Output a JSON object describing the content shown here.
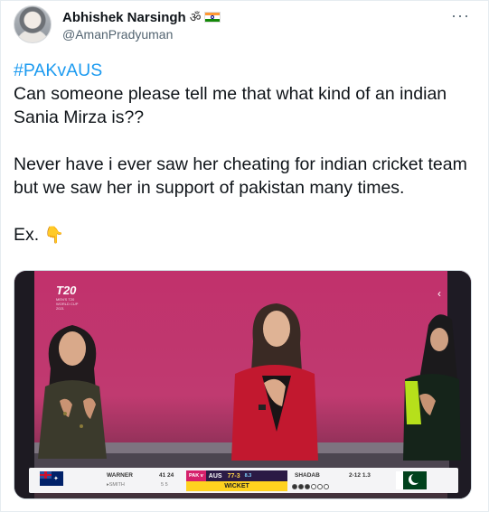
{
  "tweet": {
    "author": {
      "display_name": "Abhishek Narsingh",
      "name_emoji": "ॐ",
      "flag_icon": "india-flag-icon",
      "handle": "@AmanPradyuman"
    },
    "more_label": "···",
    "hashtag": "#PAKvAUS",
    "lines_para1": "Can someone please tell me that what kind of an indian Sania Mirza is??",
    "lines_para2": "Never have i ever saw her cheating for indian cricket team but we saw her in support of pakistan many times.",
    "lines_para3": "Ex.",
    "pointing_emoji": "👇"
  },
  "media": {
    "logo": {
      "title": "T20",
      "subtitle": "MEN'S T20 WORLD CUP 2021"
    },
    "chevron": "‹",
    "scoreboard": {
      "batter1_name": "WARNER",
      "batter1_score": "41 24",
      "batter2_name": "▸SMITH",
      "batter2_score": "5 5",
      "match_tag": "PAK v",
      "team": "AUS",
      "score": "77-3",
      "overs": "8.3",
      "event": "WICKET",
      "bowler_name": "SHADAB",
      "bowler_figures": "2-12 1.3",
      "balls": [
        "w",
        "w",
        "w",
        "o",
        "o",
        "o"
      ]
    }
  },
  "colors": {
    "hashtag": "#1d9bf0",
    "handle": "#536471",
    "background_pink": "#c1316c",
    "wicket_yellow": "#ffd21f"
  }
}
